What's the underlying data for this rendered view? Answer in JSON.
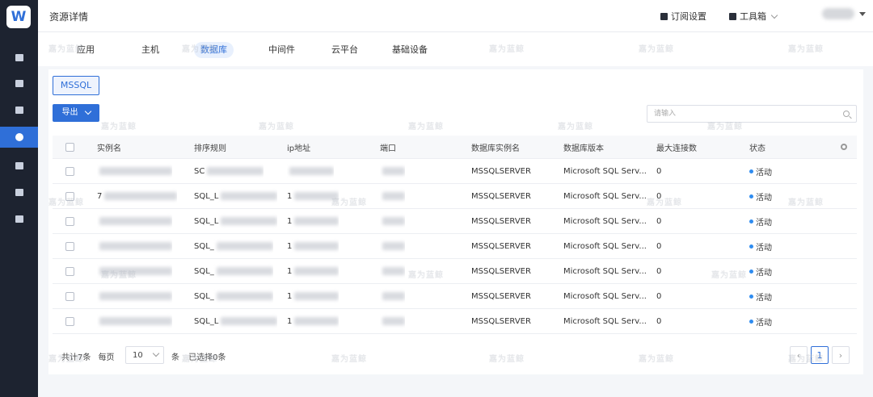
{
  "app": {
    "logo_text": "W",
    "brand_color": "#2f6fd8",
    "sidebar_bg": "#1d2330"
  },
  "sidebar": {
    "items": [
      {
        "icon": "home-icon"
      },
      {
        "icon": "document-icon"
      },
      {
        "icon": "monitor-icon"
      },
      {
        "icon": "resource-icon",
        "active": true
      },
      {
        "icon": "disk-icon"
      },
      {
        "icon": "chat-icon"
      },
      {
        "icon": "grid-icon"
      }
    ]
  },
  "header": {
    "title": "资源详情",
    "subscribe_label": "订阅设置",
    "toolbox_label": "工具箱"
  },
  "tabs": [
    "应用",
    "主机",
    "数据库",
    "中间件",
    "云平台",
    "基础设备"
  ],
  "active_tab": "数据库",
  "db_type_tab": "MSSQL",
  "export_label": "导出",
  "search": {
    "placeholder": "请输入"
  },
  "table": {
    "columns": [
      "实例名",
      "排序规则",
      "ip地址",
      "端口",
      "数据库实例名",
      "数据库版本",
      "最大连接数",
      "状态"
    ],
    "rows": [
      {
        "instance_name": "",
        "collation": "SC",
        "ip": "",
        "port": "",
        "db_instance": "MSSQLSERVER",
        "version": "Microsoft SQL Serv...",
        "max_conn": "0",
        "status": "活动"
      },
      {
        "instance_name": "7",
        "collation": "SQL_L",
        "ip": "1",
        "port": "",
        "db_instance": "MSSQLSERVER",
        "version": "Microsoft SQL Serv...",
        "max_conn": "0",
        "status": "活动"
      },
      {
        "instance_name": "",
        "collation": "SQL_L",
        "ip": "1",
        "port": "",
        "db_instance": "MSSQLSERVER",
        "version": "Microsoft SQL Serv...",
        "max_conn": "0",
        "status": "活动"
      },
      {
        "instance_name": "",
        "collation": "SQL_",
        "ip": "1",
        "port": "",
        "db_instance": "MSSQLSERVER",
        "version": "Microsoft SQL Serv...",
        "max_conn": "0",
        "status": "活动"
      },
      {
        "instance_name": "",
        "collation": "SQL_",
        "ip": "1",
        "port": "",
        "db_instance": "MSSQLSERVER",
        "version": "Microsoft SQL Serv...",
        "max_conn": "0",
        "status": "活动"
      },
      {
        "instance_name": "",
        "collation": "SQL_",
        "ip": "1",
        "port": "",
        "db_instance": "MSSQLSERVER",
        "version": "Microsoft SQL Serv...",
        "max_conn": "0",
        "status": "活动"
      },
      {
        "instance_name": "",
        "collation": "SQL_L",
        "ip": "1",
        "port": "",
        "db_instance": "MSSQLSERVER",
        "version": "Microsoft SQL Serv...",
        "max_conn": "0",
        "status": "活动"
      }
    ]
  },
  "footer": {
    "total_label": "共计7条",
    "per_page_label": "每页",
    "page_size": "10",
    "unit_label": "条",
    "selected_label": "已选择0条",
    "current_page": "1"
  },
  "watermark": "嘉为蓝鲸",
  "status_color": "#2f8cf0"
}
